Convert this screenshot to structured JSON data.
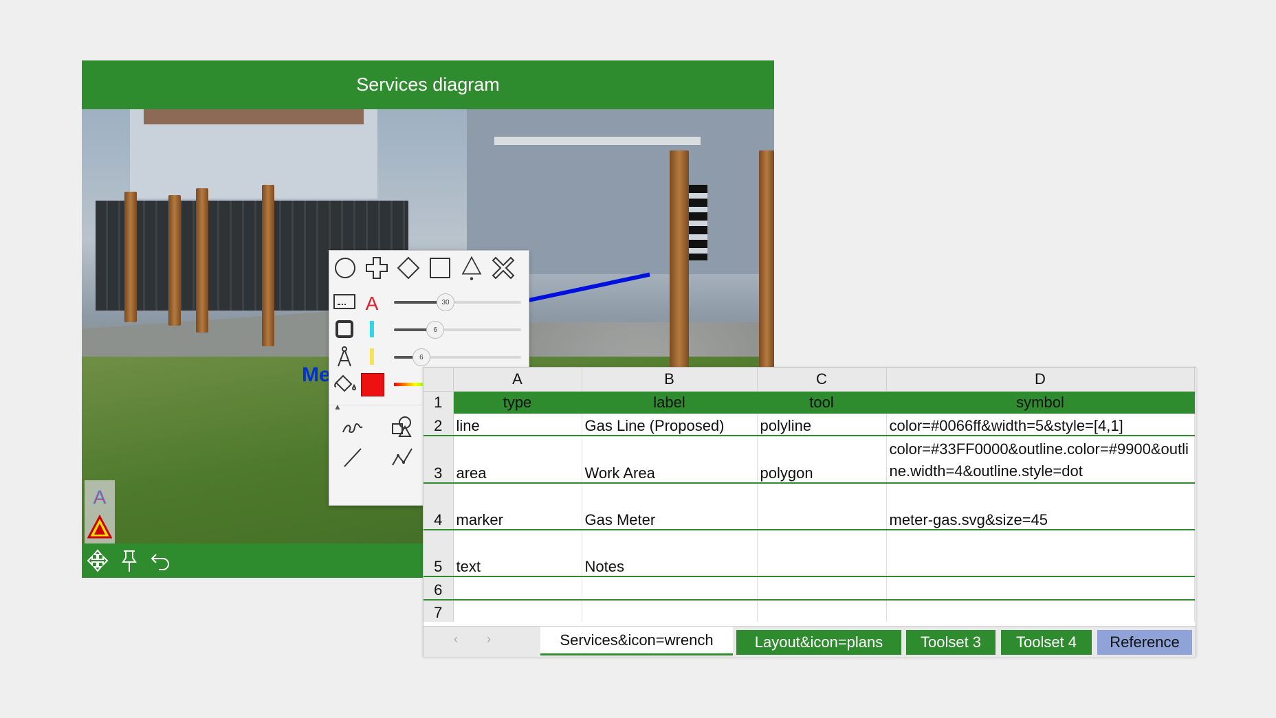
{
  "app": {
    "title": "Services diagram",
    "map_label": "Me",
    "footer_icons": [
      "move-icon",
      "pin-icon",
      "undo-icon"
    ]
  },
  "palette": {
    "shapes": [
      "circle-icon",
      "plus-icon",
      "diamond-icon",
      "square-icon",
      "triangle-icon",
      "x-icon"
    ],
    "sliders": [
      {
        "name": "text-size",
        "value": "30",
        "level": 0.4
      },
      {
        "name": "outline-width",
        "value": "6",
        "level": 0.32
      },
      {
        "name": "line-width",
        "value": "6",
        "level": 0.21
      }
    ],
    "fill_color": "#ee1111",
    "draw_tools": [
      "freehand-icon",
      "shapes-icon",
      "line-icon",
      "polyline-icon"
    ]
  },
  "sheet": {
    "columns": [
      "A",
      "B",
      "C",
      "D"
    ],
    "header_row": {
      "num": "1",
      "cells": [
        "type",
        "label",
        "tool",
        "symbol"
      ]
    },
    "rows": [
      {
        "num": "2",
        "cells": [
          "line",
          "Gas Line (Proposed)",
          "polyline",
          "color=#0066ff&width=5&style=[4,1]"
        ]
      },
      {
        "num": "3",
        "cells": [
          "area",
          "Work Area",
          "polygon",
          "color=#33FF0000&outline.color=#9900&outline.width=4&outline.style=dot"
        ]
      },
      {
        "num": "4",
        "cells": [
          "marker",
          "Gas Meter",
          "",
          "meter-gas.svg&size=45"
        ]
      },
      {
        "num": "5",
        "cells": [
          "text",
          "Notes",
          "",
          ""
        ]
      },
      {
        "num": "6",
        "cells": [
          "",
          "",
          "",
          ""
        ]
      },
      {
        "num": "7",
        "cells": [
          "",
          "",
          "",
          ""
        ]
      }
    ],
    "tabs": [
      "Services&icon=wrench",
      "Layout&icon=plans",
      "Toolset 3",
      "Toolset 4",
      "Reference"
    ]
  },
  "colors": {
    "brand_green": "#2e8b2e",
    "reference_tab": "#8fa3d8",
    "gas_line": "#0011dd"
  }
}
